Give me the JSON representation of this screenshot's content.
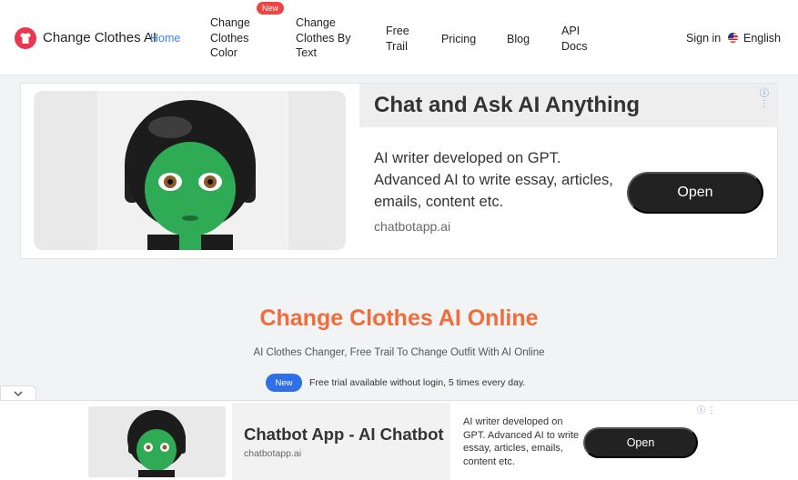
{
  "header": {
    "logo_text": "Change Clothes AI",
    "nav": {
      "home": "Home",
      "change_clothes_color": [
        "Change",
        "Clothes",
        "Color"
      ],
      "change_clothes_by_text": [
        "Change",
        "Clothes By",
        "Text"
      ],
      "free_trail": [
        "Free",
        "Trail"
      ],
      "pricing": "Pricing",
      "blog": "Blog",
      "api_docs": [
        "API",
        "Docs"
      ]
    },
    "badge_new": "New",
    "sign_in": "Sign in",
    "language": "English"
  },
  "ad_top": {
    "title": "Chat and Ask AI Anything",
    "description": "AI writer developed on GPT. Advanced AI to write essay, articles, emails, content etc.",
    "domain": "chatbotapp.ai",
    "button": "Open"
  },
  "hero": {
    "title": "Change Clothes AI Online",
    "subtitle": "AI Clothes Changer, Free Trail To Change Outfit With AI Online",
    "pill": "New",
    "trial_text": "Free trial available without login, 5 times every day."
  },
  "ad_bottom": {
    "title": "Chatbot App - AI Chatbot",
    "domain": "chatbotapp.ai",
    "description": "AI writer developed on GPT. Advanced AI to write essay, articles, emails, content etc.",
    "button": "Open"
  },
  "colors": {
    "accent_orange": "#f26b3a",
    "link_blue": "#3b82f6",
    "badge_red": "#ef4444",
    "pill_blue": "#2f6fe8",
    "logo_red": "#e8384f"
  }
}
